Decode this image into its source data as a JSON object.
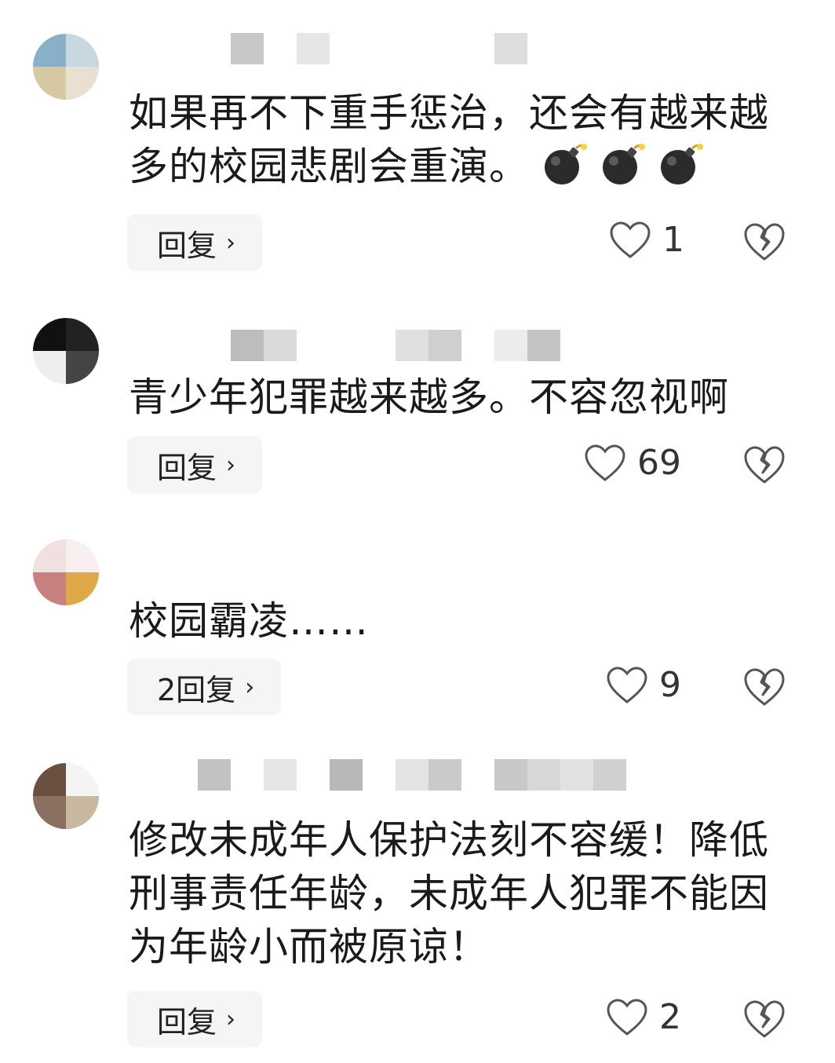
{
  "comments": [
    {
      "text": "如果再不下重手惩治，还会有越来越多的校园悲剧会重演。",
      "emoji_count": 3,
      "emoji_icon": "bomb-icon",
      "reply_label": "回复",
      "like_count": "1",
      "avatar_colors": [
        "#8ab0c8",
        "#c8d8e0",
        "#d6c8a0",
        "#e8e0d0"
      ]
    },
    {
      "text": "青少年犯罪越来越多。不容忽视啊",
      "reply_label": "回复",
      "like_count": "69",
      "avatar_colors": [
        "#111111",
        "#222222",
        "#eeeeee",
        "#444444"
      ]
    },
    {
      "text": "校园霸凌……",
      "reply_label": "2回复",
      "like_count": "9",
      "avatar_colors": [
        "#f0e0e0",
        "#f8f0f0",
        "#c88080",
        "#e0a848"
      ]
    },
    {
      "text": "修改未成年人保护法刻不容缓！降低刑事责任年龄，未成年人犯罪不能因为年龄小而被原谅！",
      "reply_label": "回复",
      "like_count": "2",
      "avatar_colors": [
        "#6a5040",
        "#f4f4f4",
        "#8a7060",
        "#c8b8a0"
      ]
    }
  ],
  "icons": {
    "like": "heart-icon",
    "dislike": "broken-heart-icon",
    "reply_chevron": "chevron-right-icon"
  },
  "colors": {
    "background": "#ffffff",
    "text": "#1a1a1a",
    "reply_bg": "#f4f5f7",
    "icon": "#555555"
  }
}
